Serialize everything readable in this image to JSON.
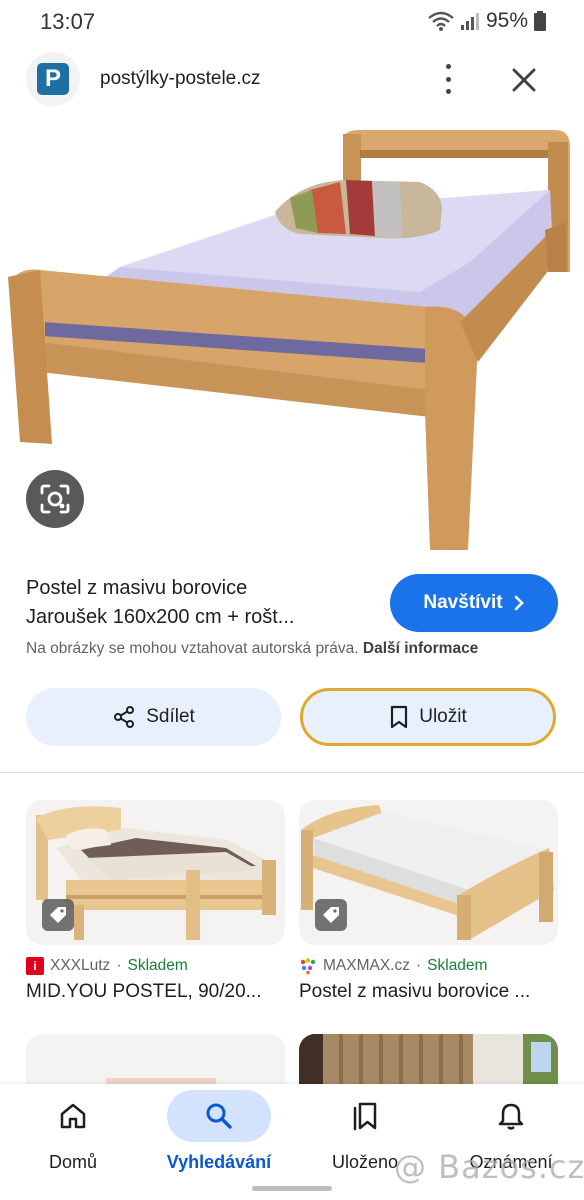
{
  "status_bar": {
    "time": "13:07",
    "battery": "95%"
  },
  "source": {
    "logo_letter": "P",
    "site_name": "postýlky-postele.cz"
  },
  "result": {
    "title_line1": "Postel z masivu borovice",
    "title_line2": "Jaroušek 160x200 cm + rošt...",
    "visit_label": "Navštívit",
    "copyright_text": "Na obrázky se mohou vztahovat autorská práva.",
    "more_info_label": "Další informace"
  },
  "actions": {
    "share_label": "Sdílet",
    "save_label": "Uložit"
  },
  "related": [
    {
      "store": "XXXLutz",
      "stock": "Skladem",
      "title": "MID.YOU POSTEL, 90/20...",
      "favicon_letter": "i"
    },
    {
      "store": "MAXMAX.cz",
      "stock": "Skladem",
      "title": "Postel z masivu borovice ..."
    }
  ],
  "separator": "·",
  "nav": [
    {
      "label": "Domů",
      "icon": "home-icon"
    },
    {
      "label": "Vyhledávání",
      "icon": "search-icon"
    },
    {
      "label": "Uloženo",
      "icon": "bookmarks-icon"
    },
    {
      "label": "Oznámení",
      "icon": "bell-icon"
    }
  ],
  "watermark": "@ Bazos.cz",
  "colors": {
    "accent": "#1a73e8",
    "stock_green": "#188038",
    "save_border": "#e0a82e",
    "nav_active_bg": "#d3e3fd"
  }
}
